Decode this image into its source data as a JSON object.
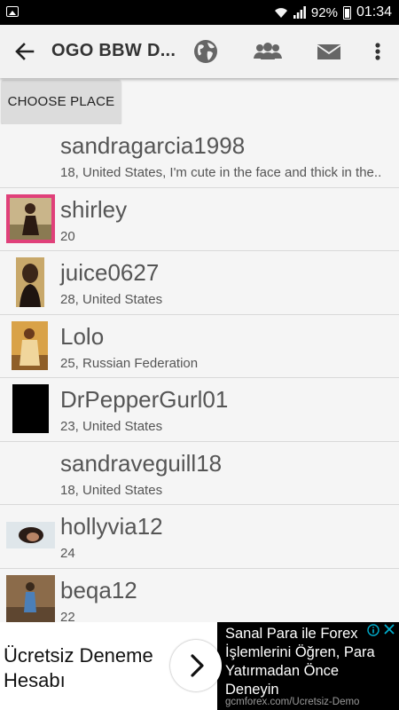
{
  "status_bar": {
    "battery": "92%",
    "time": "01:34"
  },
  "app_bar": {
    "title": "OGO BBW D...",
    "icons": [
      "back-arrow-icon",
      "globe-icon",
      "group-icon",
      "mail-icon",
      "overflow-menu-icon"
    ]
  },
  "choose_place": {
    "label": "CHOOSE PLACE"
  },
  "users": [
    {
      "name": "sandragarcia1998",
      "desc": "18, United States, I'm cute in the face and thick in the..",
      "avatar": "none"
    },
    {
      "name": "shirley",
      "desc": "20",
      "avatar": "photo"
    },
    {
      "name": "juice0627",
      "desc": "28, United States",
      "avatar": "photo"
    },
    {
      "name": "Lolo",
      "desc": "25, Russian Federation",
      "avatar": "photo"
    },
    {
      "name": "DrPepperGurl01",
      "desc": "23, United States",
      "avatar": "photo"
    },
    {
      "name": "sandraveguill18",
      "desc": "18, United States",
      "avatar": "none"
    },
    {
      "name": "hollyvia12",
      "desc": "24",
      "avatar": "photo"
    },
    {
      "name": "beqa12",
      "desc": "22",
      "avatar": "photo"
    }
  ],
  "ad": {
    "headline": "Ücretsiz Deneme Hesabı",
    "body": "Sanal Para ile Forex İşlemlerini Öğren, Para Yatırmadan Önce Deneyin",
    "url": "gcmforex.com/Ucretsiz-Demo",
    "icons": [
      "chevron-right-icon",
      "adchoices-icon",
      "close-icon"
    ]
  },
  "colors": {
    "app_bar_bg": "#f2f2f2",
    "list_bg": "#f5f5f5",
    "text_gray": "#555555",
    "button_bg": "#dcdcdc",
    "ad_info_blue": "#00aecd"
  }
}
